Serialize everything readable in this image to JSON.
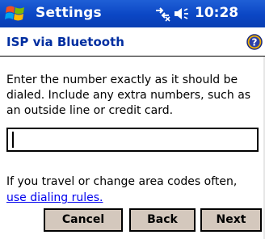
{
  "titlebar": {
    "app_title": "Settings",
    "clock": "10:28",
    "start_icon": "windows-flag-icon",
    "connectivity_icon": "connectivity-icon",
    "volume_icon": "speaker-icon"
  },
  "page": {
    "title": "ISP via Bluetooth",
    "help_icon": "help-icon",
    "instructions": "Enter the number exactly as it should be dialed.  Include any extra numbers, such as an outside line or credit card.",
    "number_field": {
      "value": "",
      "placeholder": ""
    },
    "travel_text": "If you travel or change area codes often,",
    "dialing_link": "use dialing rules."
  },
  "buttons": {
    "cancel": "Cancel",
    "back": "Back",
    "next": "Next"
  },
  "colors": {
    "titlebar": "#0b46c4",
    "header_text": "#002ea0",
    "link": "#0000ee",
    "button_face": "#d4c8bd"
  }
}
